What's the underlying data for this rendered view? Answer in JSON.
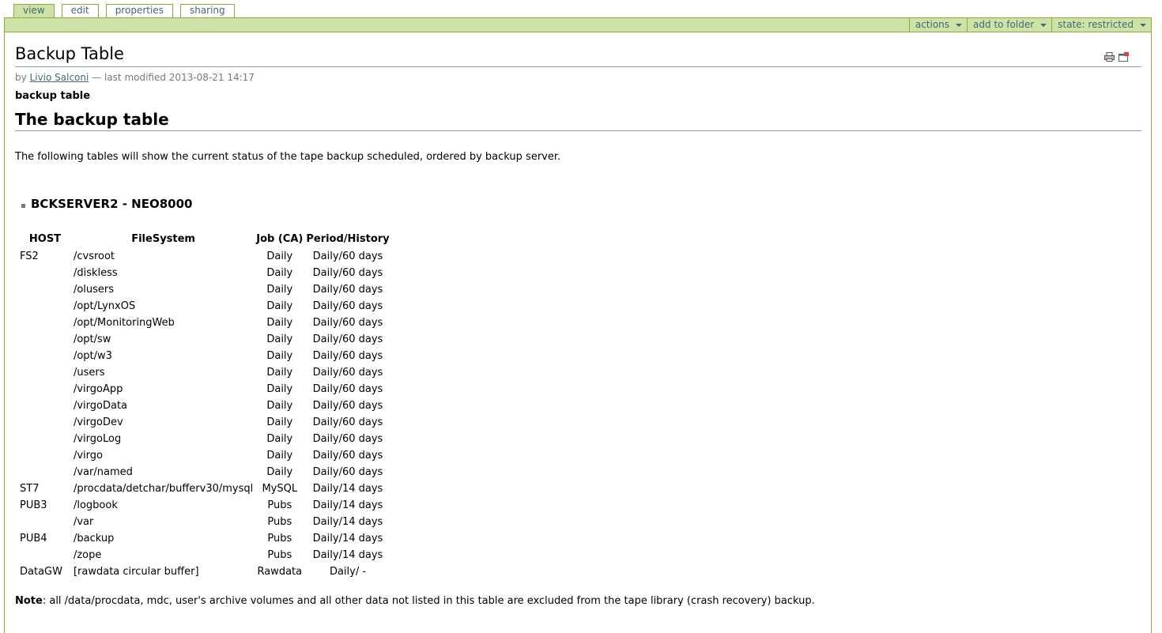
{
  "tabs": [
    {
      "label": "view",
      "active": true
    },
    {
      "label": "edit",
      "active": false
    },
    {
      "label": "properties",
      "active": false
    },
    {
      "label": "sharing",
      "active": false
    }
  ],
  "menus": [
    {
      "label": "actions"
    },
    {
      "label": "add to folder"
    },
    {
      "label": "state: restricted"
    }
  ],
  "document": {
    "title": "Backup Table",
    "byline_prefix": "by",
    "author": "Livio Salconi",
    "modified_text": "— last modified 2013-08-21 14:17",
    "description": "backup table",
    "heading": "The backup table",
    "intro": "The following tables will show the current status of the tape backup scheduled, ordered by backup server.",
    "server_title": "BCKSERVER2 - NEO8000",
    "note_label": "Note",
    "note_text": ": all /data/procdata, mdc, user's archive volumes and all other data not listed in this table are excluded from the tape library (crash recovery) backup."
  },
  "icons": {
    "print": "print-icon",
    "fullscreen": "fullscreen-icon"
  },
  "colors": {
    "accent_green": "#cde2a7",
    "border_green": "#8cac3a",
    "link": "#436976"
  },
  "table": {
    "headers": [
      "HOST",
      "FileSystem",
      "Job (CA)",
      "Period/History"
    ],
    "rows": [
      [
        "FS2",
        "/cvsroot",
        "Daily",
        "Daily/60 days"
      ],
      [
        "",
        "/diskless",
        "Daily",
        "Daily/60 days"
      ],
      [
        "",
        "/olusers",
        "Daily",
        "Daily/60 days"
      ],
      [
        "",
        "/opt/LynxOS",
        "Daily",
        "Daily/60 days"
      ],
      [
        "",
        "/opt/MonitoringWeb",
        "Daily",
        "Daily/60 days"
      ],
      [
        "",
        "/opt/sw",
        "Daily",
        "Daily/60 days"
      ],
      [
        "",
        "/opt/w3",
        "Daily",
        "Daily/60 days"
      ],
      [
        "",
        "/users",
        "Daily",
        "Daily/60 days"
      ],
      [
        "",
        "/virgoApp",
        "Daily",
        "Daily/60 days"
      ],
      [
        "",
        "/virgoData",
        "Daily",
        "Daily/60 days"
      ],
      [
        "",
        "/virgoDev",
        "Daily",
        "Daily/60 days"
      ],
      [
        "",
        "/virgoLog",
        "Daily",
        "Daily/60 days"
      ],
      [
        "",
        "/virgo",
        "Daily",
        "Daily/60 days"
      ],
      [
        "",
        "/var/named",
        "Daily",
        "Daily/60 days"
      ],
      [
        "ST7",
        "/procdata/detchar/bufferv30/mysql",
        "MySQL",
        "Daily/14 days"
      ],
      [
        "PUB3",
        "/logbook",
        "Pubs",
        "Daily/14 days"
      ],
      [
        "",
        "/var",
        "Pubs",
        "Daily/14 days"
      ],
      [
        "PUB4",
        "/backup",
        "Pubs",
        "Daily/14 days"
      ],
      [
        "",
        "/zope",
        "Pubs",
        "Daily/14 days"
      ],
      [
        "DataGW",
        "[rawdata circular buffer]",
        "Rawdata",
        "Daily/ -"
      ]
    ]
  }
}
